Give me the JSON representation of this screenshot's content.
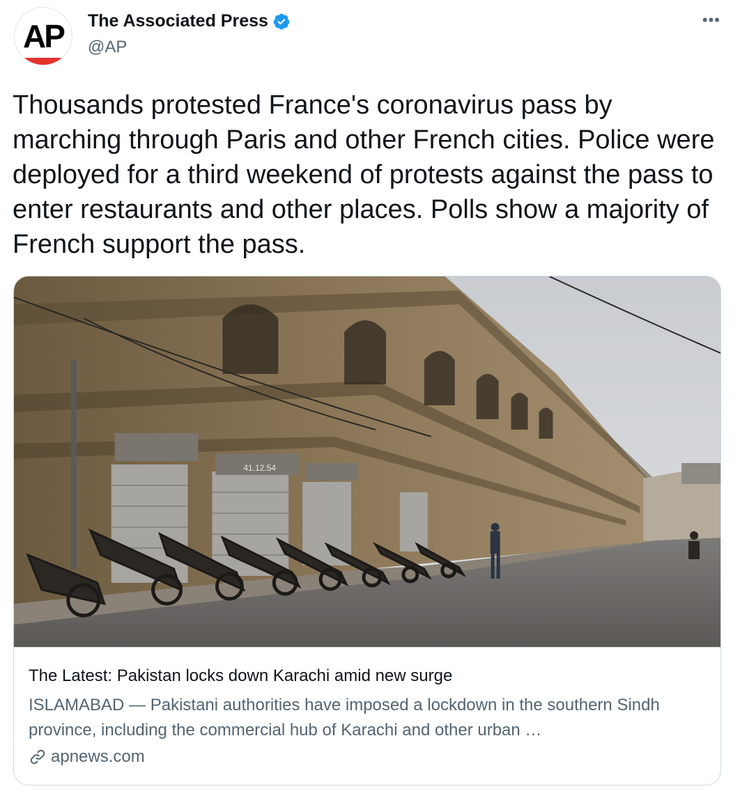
{
  "author": {
    "display_name": "The Associated Press",
    "handle": "@AP",
    "avatar_text": "AP",
    "verified": true,
    "verified_icon": "verified-badge-icon",
    "brand_color": "#e4322c",
    "verified_color": "#1d9bf0"
  },
  "menu": {
    "more_label": "•••"
  },
  "tweet": {
    "text": "Thousands protested France's coronavirus pass by marching through Paris and other French cities. Police were deployed for a third weekend of protests against the pass to enter restaurants and other places. Polls show a majority of French support the pass."
  },
  "card": {
    "title": "The Latest: Pakistan locks down Karachi amid new surge",
    "description": "ISLAMABAD — Pakistani authorities have imposed a lockdown in the southern Sindh province, including the commercial hub of Karachi and other urban …",
    "domain": "apnews.com",
    "link_icon": "link-icon",
    "image_sign_text": "41.12.54"
  }
}
